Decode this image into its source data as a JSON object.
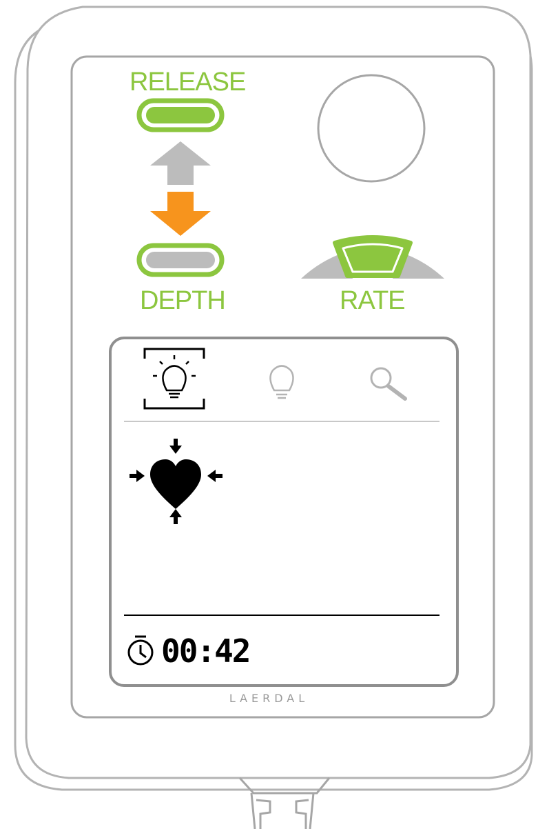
{
  "feedback_panel": {
    "release_label": "RELEASE",
    "depth_label": "DEPTH",
    "rate_label": "RATE"
  },
  "display": {
    "tabs": [
      {
        "icon": "lightbulb-active-icon",
        "selected": true
      },
      {
        "icon": "lightbulb-icon",
        "selected": false
      },
      {
        "icon": "magnifier-icon",
        "selected": false
      }
    ],
    "status_icon": "heart-compression-icon",
    "timer": {
      "icon": "stopwatch-icon",
      "value": "00:42"
    }
  },
  "brand": "LAERDAL",
  "colors": {
    "green": "#8cc63f",
    "orange": "#f7941d",
    "gray": "#bcbcbc",
    "outline": "#a6a6a6"
  }
}
